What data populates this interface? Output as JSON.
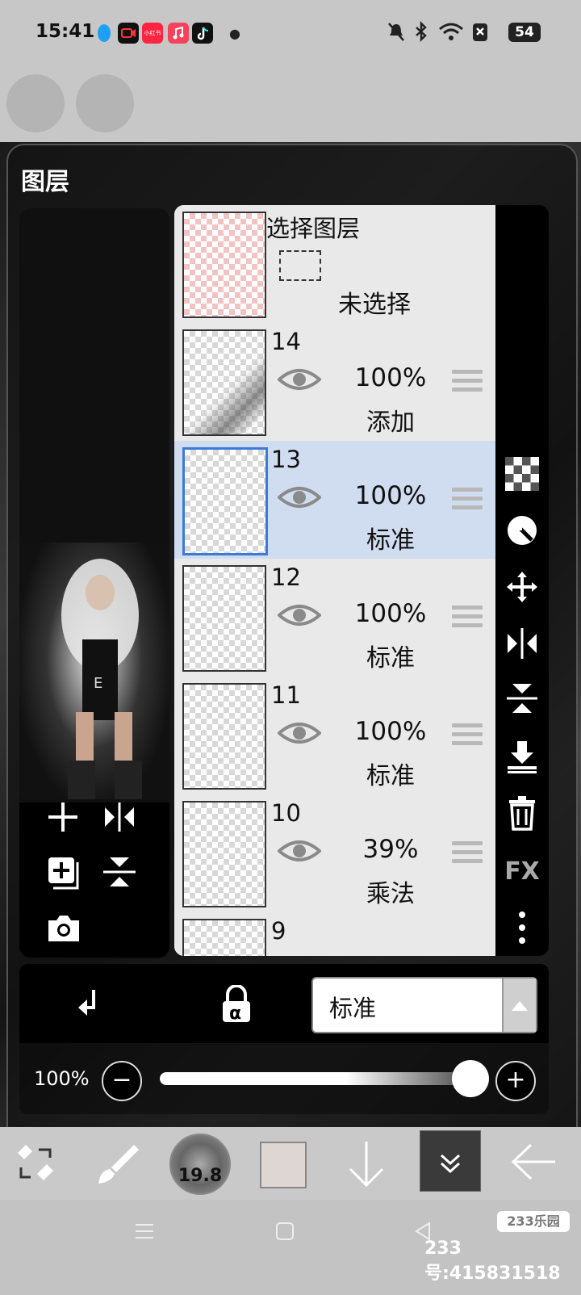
{
  "status_bar": {
    "time": "15:41",
    "battery": "54",
    "icons": [
      "qq-icon",
      "video-icon",
      "xiaohongshu-icon",
      "music-icon",
      "tiktok-icon",
      "mute-icon",
      "bluetooth-icon",
      "wifi-icon",
      "sim-off-icon"
    ],
    "xhs_label": "小红书"
  },
  "panel": {
    "title": "图层"
  },
  "layers": [
    {
      "name": "选择图层",
      "status": "未选择",
      "type": "selection"
    },
    {
      "name": "14",
      "opacity": "100%",
      "blend": "添加",
      "selected": false
    },
    {
      "name": "13",
      "opacity": "100%",
      "blend": "标准",
      "selected": true
    },
    {
      "name": "12",
      "opacity": "100%",
      "blend": "标准",
      "selected": false
    },
    {
      "name": "11",
      "opacity": "100%",
      "blend": "标准",
      "selected": false
    },
    {
      "name": "10",
      "opacity": "39%",
      "blend": "乘法",
      "selected": false
    },
    {
      "name": "9"
    }
  ],
  "right_tools": [
    "checker-icon",
    "circle-half-icon",
    "move-icon",
    "flip-horizontal-icon",
    "flip-vertical-icon",
    "merge-down-icon",
    "trash-icon",
    "fx-icon",
    "more-vertical-icon"
  ],
  "fx_label": "FX",
  "left_tools": [
    "add-layer-icon",
    "flip-icon",
    "copy-layer-icon",
    "flip-v-icon",
    "camera-icon"
  ],
  "controls": {
    "blend_mode": "标准",
    "opacity_label": "100%",
    "opacity_value": 1.0,
    "alpha_lock": "α"
  },
  "toolbar": {
    "brush_size": "19.8",
    "color": "#ddd6d2"
  },
  "watermark": {
    "logo": "233乐园",
    "text": "233号:415831518"
  }
}
